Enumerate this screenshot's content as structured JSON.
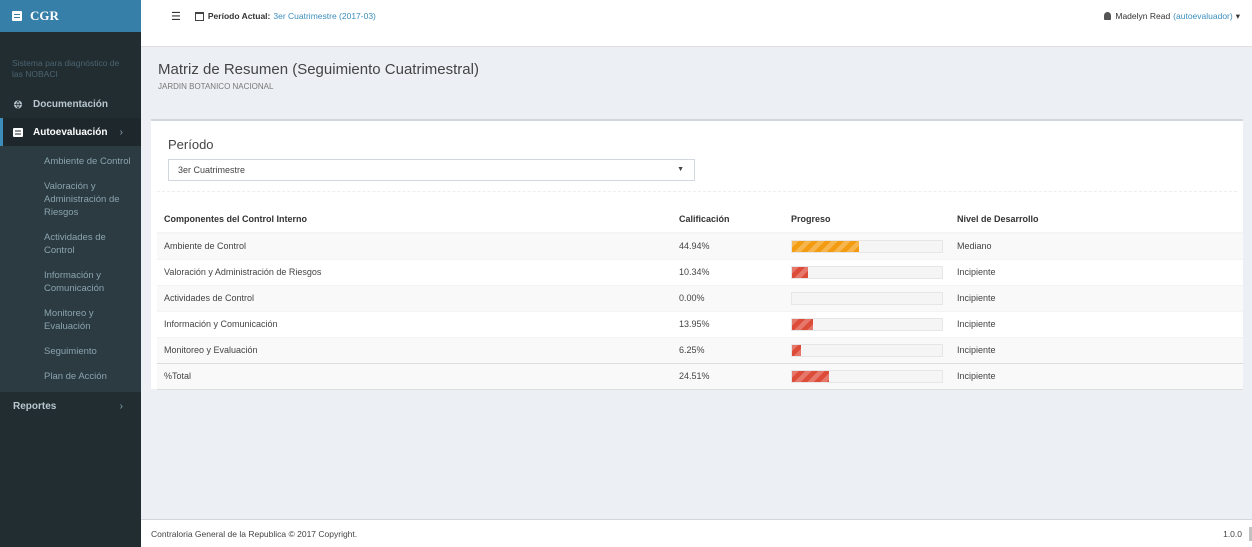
{
  "brand": {
    "name": "CGR"
  },
  "sidebar": {
    "system_text": "Sistema para diagnóstico de las NOBACI",
    "items": [
      {
        "label": "Documentación"
      },
      {
        "label": "Autoevaluación",
        "chevron": "›"
      },
      {
        "label": "Reportes",
        "chevron": "›"
      }
    ],
    "subitems": [
      "Ambiente de Control",
      "Valoración y Administración de Riesgos",
      "Actividades de Control",
      "Información y Comunicación",
      "Monitoreo y Evaluación",
      "Seguimiento",
      "Plan de Acción"
    ]
  },
  "topbar": {
    "period_label": "Período Actual:",
    "period_value": "3er Cuatrimestre (2017-03)",
    "user_name": "Madelyn Read",
    "user_role": "(autoevaluador)",
    "user_caret": "▾"
  },
  "page": {
    "title": "Matriz de Resumen (Seguimiento Cuatrimestral)",
    "subtitle": "JARDIN BOTANICO NACIONAL"
  },
  "filter": {
    "label": "Período",
    "selected": "3er Cuatrimestre"
  },
  "table": {
    "headers": [
      "Componentes del Control Interno",
      "Calificación",
      "Progreso",
      "Nivel de Desarrollo"
    ],
    "rows": [
      {
        "component": "Ambiente de Control",
        "score": "44.94%",
        "progress": 44.94,
        "level": "Mediano",
        "status": "warn"
      },
      {
        "component": "Valoración y Administración de Riesgos",
        "score": "10.34%",
        "progress": 10.34,
        "level": "Incipiente",
        "status": "danger"
      },
      {
        "component": "Actividades de Control",
        "score": "0.00%",
        "progress": 0,
        "level": "Incipiente",
        "status": "danger"
      },
      {
        "component": "Información y Comunicación",
        "score": "13.95%",
        "progress": 13.95,
        "level": "Incipiente",
        "status": "danger"
      },
      {
        "component": "Monitoreo y Evaluación",
        "score": "6.25%",
        "progress": 6.25,
        "level": "Incipiente",
        "status": "danger"
      },
      {
        "component": "%Total",
        "score": "24.51%",
        "progress": 24.51,
        "level": "Incipiente",
        "status": "danger"
      }
    ]
  },
  "footer": {
    "copyright": "Contraloria General de la Republica © 2017 Copyright.",
    "version": "1.0.0"
  },
  "colors": {
    "sidebar": "#222d32",
    "accent": "#3c8dbc",
    "warning": "#f39c12",
    "danger": "#dd4b39"
  }
}
